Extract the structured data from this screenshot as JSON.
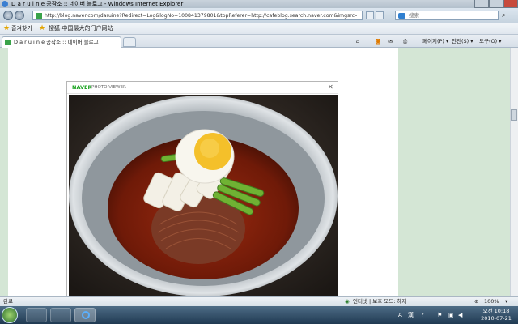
{
  "window": {
    "title": "D a r u i n e  공작소 :: 네이버 블로그 - Windows Internet Explorer"
  },
  "address": {
    "url": "http://blog.naver.com/daruine?Redirect=Log&logNo=100841379801&topReferer=http://cafeblog.search.naver.com&imgsrc=c.20100408_273/de"
  },
  "search": {
    "placeholder": "搜索"
  },
  "favorites": {
    "label": "즐겨찾기",
    "item": "搜狐-中国最大的门户网站"
  },
  "tab": {
    "label": "D a r u i n e  공작소 :: 네이버 블로그"
  },
  "commands": {
    "page": "페이지(P) ▾",
    "safety": "안전(S) ▾",
    "tools": "도구(O) ▾"
  },
  "viewer": {
    "brand": "NAVER",
    "subtitle": "PHOTO VIEWER",
    "close": "✕"
  },
  "status": {
    "left": "완료",
    "zone": "인터넷 | 보호 모드: 해제",
    "zoom": "100%"
  },
  "taskbar": {
    "time": "오전 10:18",
    "date": "2010-07-21",
    "lang": "A",
    "kr": "漢"
  },
  "colors": {
    "accent": "#1aa320",
    "pane": "#d4e6d5"
  }
}
